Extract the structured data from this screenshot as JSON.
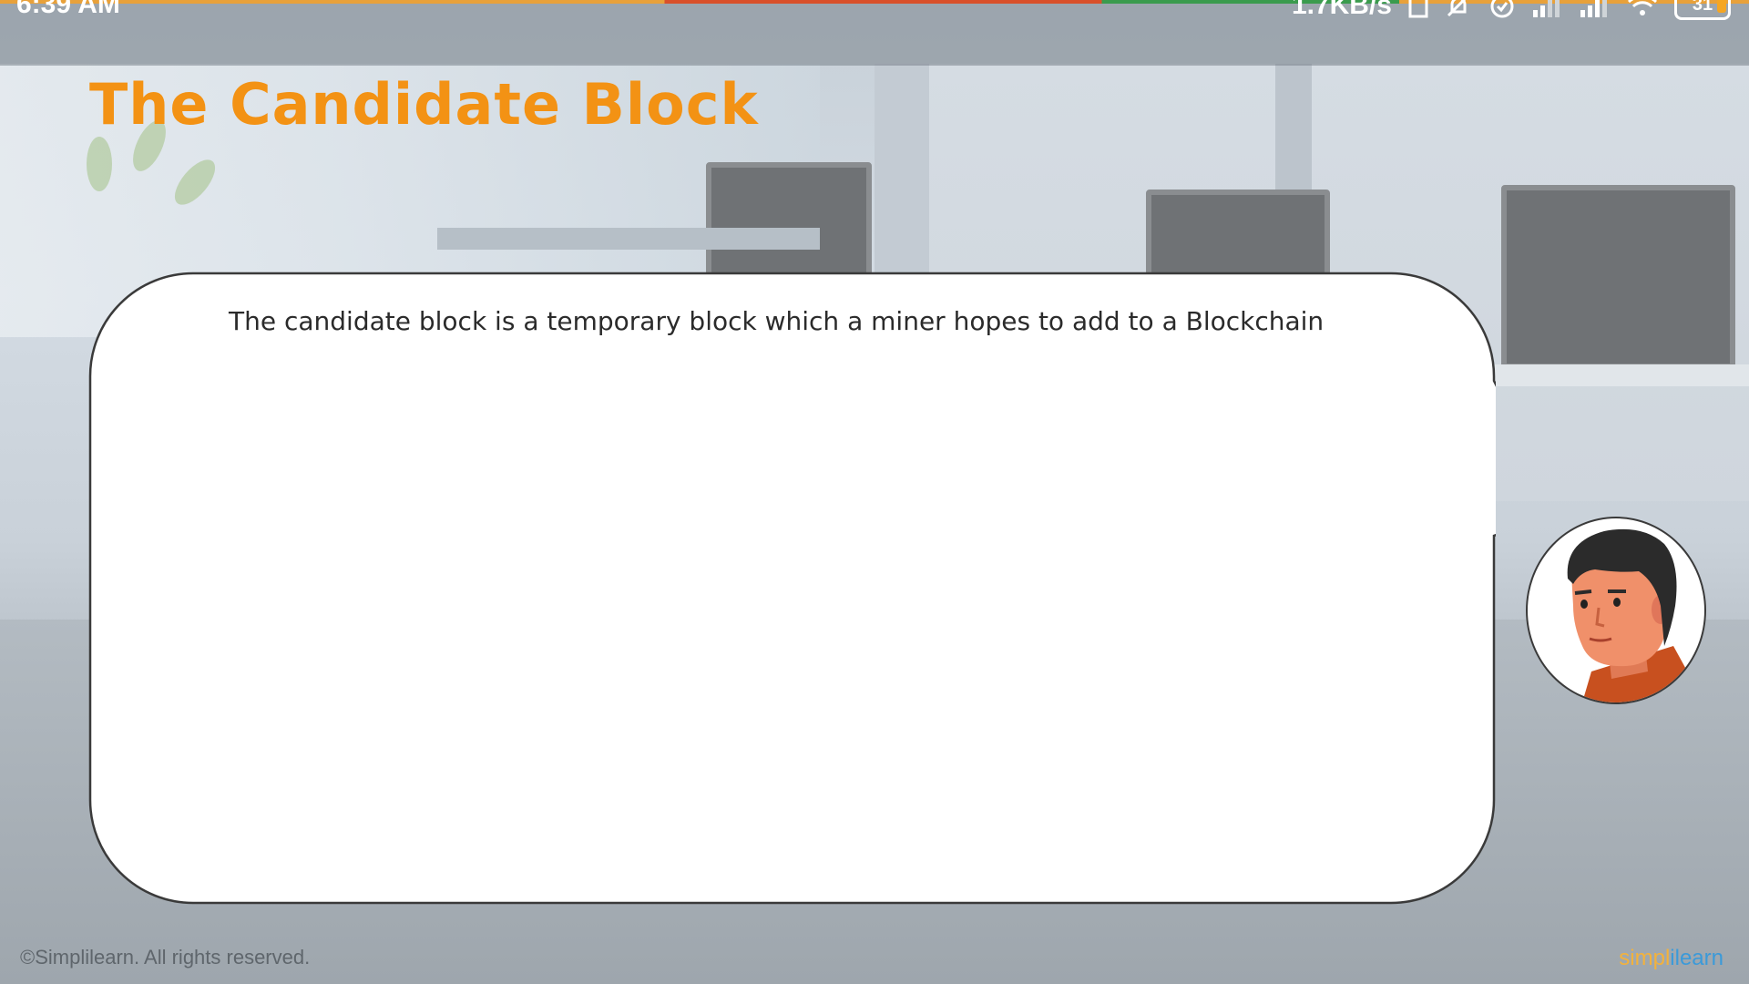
{
  "status_bar": {
    "time": "6:39 AM",
    "network_speed": "1.7KB/s",
    "battery_level": "31",
    "icons": [
      "sim-card-icon",
      "muted-notification-icon",
      "alarm-icon",
      "signal-icon",
      "signal-icon",
      "wifi-icon",
      "battery-icon"
    ],
    "accent_colors": [
      "#e8a13a",
      "#d9502a",
      "#3a9b4d"
    ]
  },
  "slide": {
    "title": "The Candidate Block",
    "title_color": "#f39214",
    "speech_bubble": {
      "text": "The candidate block is a temporary block which a miner hopes to add to a Blockchain"
    },
    "avatar": {
      "icon": "presenter-avatar-icon"
    }
  },
  "footer": {
    "copyright": "©Simplilearn. All rights reserved.",
    "logo_part1": "simpl",
    "logo_part2": "ilearn",
    "logo_colors": [
      "#f3b23c",
      "#3b9ad9"
    ]
  }
}
